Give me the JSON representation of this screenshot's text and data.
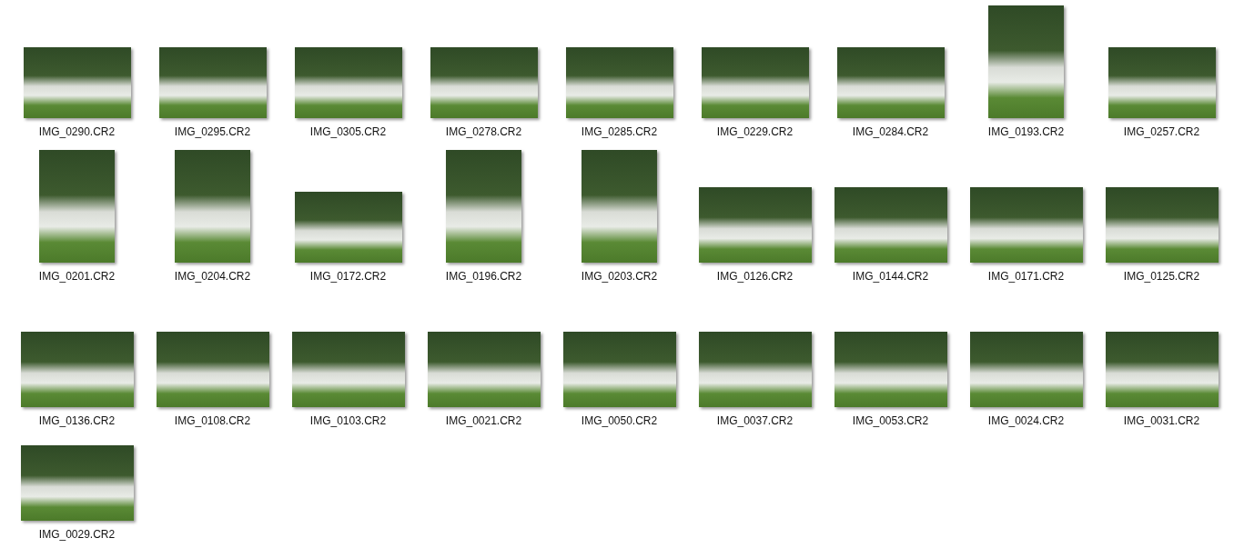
{
  "files": [
    {
      "name": "IMG_0290.CR2",
      "kind": "landscape"
    },
    {
      "name": "IMG_0295.CR2",
      "kind": "landscape"
    },
    {
      "name": "IMG_0305.CR2",
      "kind": "landscape"
    },
    {
      "name": "IMG_0278.CR2",
      "kind": "landscape"
    },
    {
      "name": "IMG_0285.CR2",
      "kind": "landscape"
    },
    {
      "name": "IMG_0229.CR2",
      "kind": "landscape"
    },
    {
      "name": "IMG_0284.CR2",
      "kind": "landscape"
    },
    {
      "name": "IMG_0193.CR2",
      "kind": "portrait"
    },
    {
      "name": "IMG_0257.CR2",
      "kind": "landscape"
    },
    {
      "name": "IMG_0201.CR2",
      "kind": "portrait"
    },
    {
      "name": "IMG_0204.CR2",
      "kind": "portrait"
    },
    {
      "name": "IMG_0172.CR2",
      "kind": "landscape"
    },
    {
      "name": "IMG_0196.CR2",
      "kind": "portrait"
    },
    {
      "name": "IMG_0203.CR2",
      "kind": "portrait"
    },
    {
      "name": "IMG_0126.CR2",
      "kind": "wide"
    },
    {
      "name": "IMG_0144.CR2",
      "kind": "wide"
    },
    {
      "name": "IMG_0171.CR2",
      "kind": "wide"
    },
    {
      "name": "IMG_0125.CR2",
      "kind": "wide"
    },
    {
      "name": "IMG_0136.CR2",
      "kind": "wide"
    },
    {
      "name": "IMG_0108.CR2",
      "kind": "wide"
    },
    {
      "name": "IMG_0103.CR2",
      "kind": "wide"
    },
    {
      "name": "IMG_0021.CR2",
      "kind": "wide"
    },
    {
      "name": "IMG_0050.CR2",
      "kind": "wide"
    },
    {
      "name": "IMG_0037.CR2",
      "kind": "wide"
    },
    {
      "name": "IMG_0053.CR2",
      "kind": "wide"
    },
    {
      "name": "IMG_0024.CR2",
      "kind": "wide"
    },
    {
      "name": "IMG_0031.CR2",
      "kind": "wide"
    },
    {
      "name": "IMG_0029.CR2",
      "kind": "wide"
    }
  ]
}
